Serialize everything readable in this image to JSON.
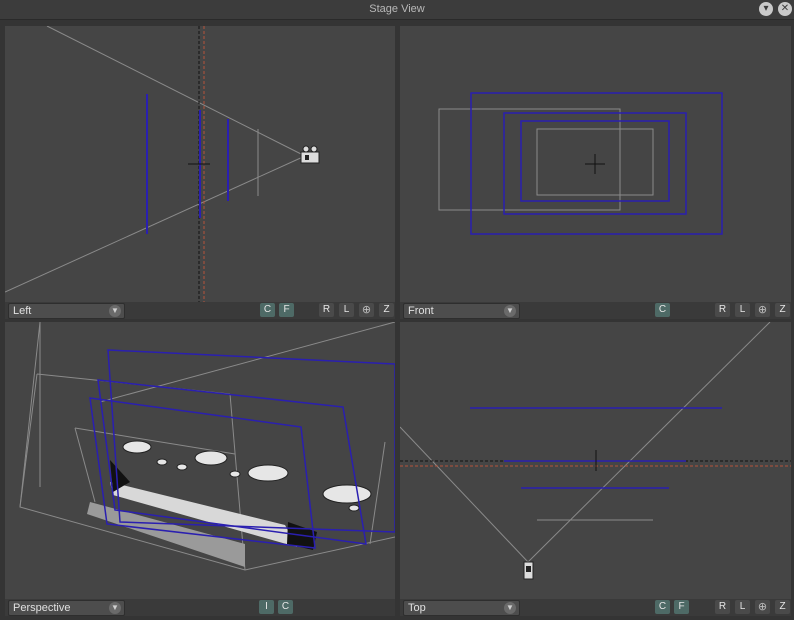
{
  "window": {
    "title": "Stage View"
  },
  "colors": {
    "camera_plane": "#2a1fb0",
    "guide": "#888888",
    "field_guide": "#b5533a"
  },
  "viewports": {
    "left": {
      "view_name": "Left",
      "toggles": [
        "C",
        "F"
      ],
      "nav": [
        "R",
        "L",
        "pan",
        "Z"
      ]
    },
    "front": {
      "view_name": "Front",
      "toggles": [
        "C"
      ],
      "nav": [
        "R",
        "L",
        "pan",
        "Z"
      ]
    },
    "perspective": {
      "view_name": "Perspective",
      "toggles": [
        "I",
        "C"
      ]
    },
    "top": {
      "view_name": "Top",
      "toggles": [
        "C",
        "F"
      ],
      "nav": [
        "R",
        "L",
        "pan",
        "Z"
      ]
    }
  },
  "icons": {
    "menu": "chevron-down-icon",
    "close": "close-icon",
    "dropdown": "chevron-down-icon",
    "pan": "crosshair-pan-icon",
    "camera": "camera-icon"
  }
}
